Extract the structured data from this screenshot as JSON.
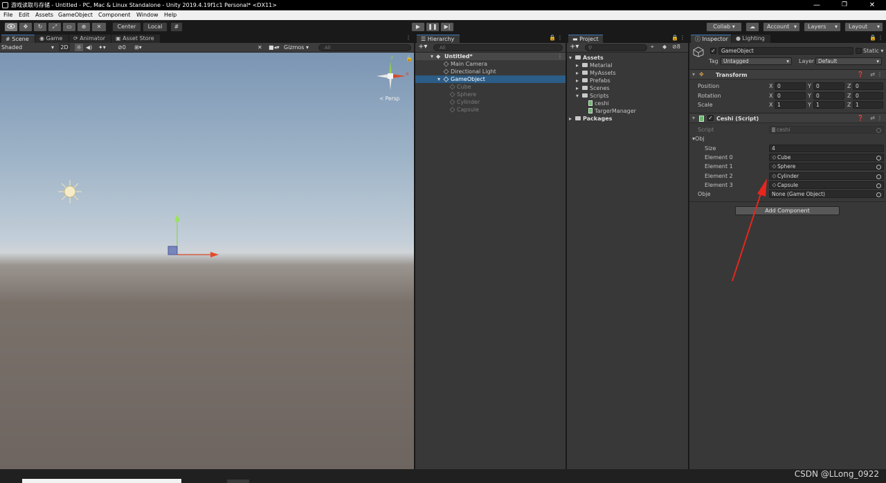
{
  "window": {
    "title": "游戏读取与存储 - Untitled - PC, Mac & Linux Standalone - Unity 2019.4.19f1c1 Personal* <DX11>",
    "min_glyph": "—",
    "max_glyph": "❐",
    "close_glyph": "✕"
  },
  "menu": [
    "File",
    "Edit",
    "Assets",
    "GameObject",
    "Component",
    "Window",
    "Help"
  ],
  "toolbar": {
    "pivot": "Center",
    "space": "Local",
    "collab": "Collab ▾",
    "account": "Account",
    "layers": "Layers",
    "layout": "Layout"
  },
  "scene": {
    "tabs": [
      "Scene",
      "Game",
      "Animator",
      "Asset Store"
    ],
    "shading": "Shaded",
    "mode_2d": "2D",
    "hidden_count": "0",
    "gizmos": "Gizmos",
    "search_placeholder": "All",
    "persp": "Persp",
    "axis_y": "y",
    "axis_x": "x"
  },
  "hierarchy": {
    "tab": "Hierarchy",
    "search_placeholder": "All",
    "scene_name": "Untitled*",
    "items": [
      {
        "label": "Main Camera",
        "dim": false
      },
      {
        "label": "Directional Light",
        "dim": false
      },
      {
        "label": "GameObject",
        "dim": false,
        "selected": true
      },
      {
        "label": "Cube",
        "dim": true
      },
      {
        "label": "Sphere",
        "dim": true
      },
      {
        "label": "Cylinder",
        "dim": true
      },
      {
        "label": "Capsule",
        "dim": true
      }
    ]
  },
  "project": {
    "tab": "Project",
    "hidden_count": "8",
    "root": "Assets",
    "folders": [
      "Metarial",
      "MyAssets",
      "Prefabs",
      "Scenes",
      "Scripts"
    ],
    "scripts": [
      "ceshi",
      "TargerManager"
    ],
    "packages": "Packages"
  },
  "inspector": {
    "tabs": [
      "Inspector",
      "Lighting"
    ],
    "object_name": "GameObject",
    "static_label": "Static",
    "tag_label": "Tag",
    "tag_value": "Untagged",
    "layer_label": "Layer",
    "layer_value": "Default",
    "transform": {
      "title": "Transform",
      "rows": [
        {
          "label": "Position",
          "x": "0",
          "y": "0",
          "z": "0"
        },
        {
          "label": "Rotation",
          "x": "0",
          "y": "0",
          "z": "0"
        },
        {
          "label": "Scale",
          "x": "1",
          "y": "1",
          "z": "1"
        }
      ]
    },
    "script_component": {
      "title": "Ceshi (Script)",
      "script_label": "Script",
      "script_value": "ceshi",
      "obj_label": "Obj",
      "size_label": "Size",
      "size_value": "4",
      "elements": [
        {
          "label": "Element 0",
          "value": "Cube"
        },
        {
          "label": "Element 1",
          "value": "Sphere"
        },
        {
          "label": "Element 2",
          "value": "Cylinder"
        },
        {
          "label": "Element 3",
          "value": "Capsule"
        }
      ],
      "obje_label": "Obje",
      "obje_value": "None (Game Object)"
    },
    "add_component": "Add Component"
  },
  "watermark": "CSDN @LLong_0922",
  "colors": {
    "accent": "#3a79bb",
    "annotation_arrow": "#e8261c"
  }
}
